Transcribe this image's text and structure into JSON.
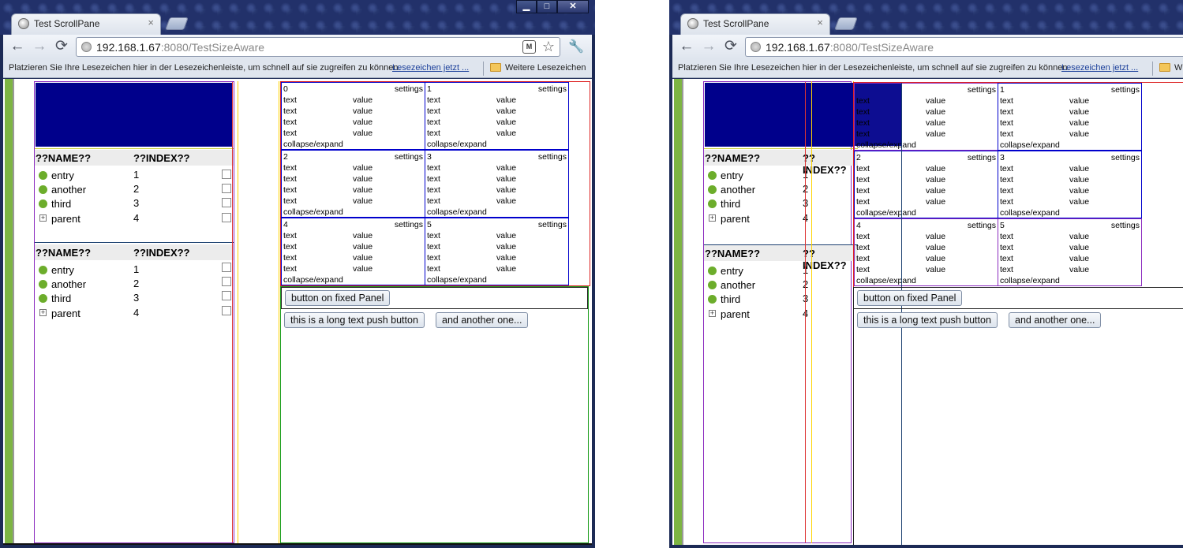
{
  "browser": {
    "tab_title": "Test ScrollPane",
    "tab_close": "×",
    "url_host": "192.168.1.67",
    "url_rest": ":8080/TestSizeAware",
    "bookmarks_prompt": "Platzieren Sie Ihre Lesezeichen hier in der Lesezeichenleiste, um schnell auf sie zugreifen zu können.",
    "bookmarks_link": "Lesezeichen jetzt ...",
    "other_bookmarks": "Weitere Lesezeichen",
    "other_bookmarks_short": "W",
    "ext_label": "M",
    "star": "☆",
    "wrench": "🔧",
    "nav": {
      "back": "←",
      "forward": "→",
      "reload": "⟳"
    },
    "window_controls": {
      "minimize": "▁",
      "maximize": "□",
      "close": "✕"
    }
  },
  "tree": {
    "col_name": "??NAME??",
    "col_index": "??INDEX??",
    "rows": [
      {
        "name": "entry",
        "index": "1",
        "icon": "leaf-dot"
      },
      {
        "name": "another",
        "index": "2",
        "icon": "leaf-dot"
      },
      {
        "name": "third",
        "index": "3",
        "icon": "leaf-dot"
      },
      {
        "name": "parent",
        "index": "4",
        "icon": "plus-box"
      }
    ],
    "plus_glyph": "+"
  },
  "cards": [
    {
      "num": "0",
      "settings": "settings",
      "text": "text",
      "value": "value",
      "collapse": "collapse/expand"
    },
    {
      "num": "1",
      "settings": "settings",
      "text": "text",
      "value": "value",
      "collapse": "collapse/expand"
    },
    {
      "num": "2",
      "settings": "settings",
      "text": "text",
      "value": "value",
      "collapse": "collapse/expand"
    },
    {
      "num": "3",
      "settings": "settings",
      "text": "text",
      "value": "value",
      "collapse": "collapse/expand"
    },
    {
      "num": "4",
      "settings": "settings",
      "text": "text",
      "value": "value",
      "collapse": "collapse/expand"
    },
    {
      "num": "5",
      "settings": "settings",
      "text": "text",
      "value": "value",
      "collapse": "collapse/expand"
    }
  ],
  "buttons": {
    "fixed_panel": "button on fixed Panel",
    "long_text": "this is a long text push button",
    "another": "and another one..."
  },
  "colors": {
    "accent_green": "#7db443",
    "navy": "#00008b",
    "card_border": "#0000cc"
  }
}
